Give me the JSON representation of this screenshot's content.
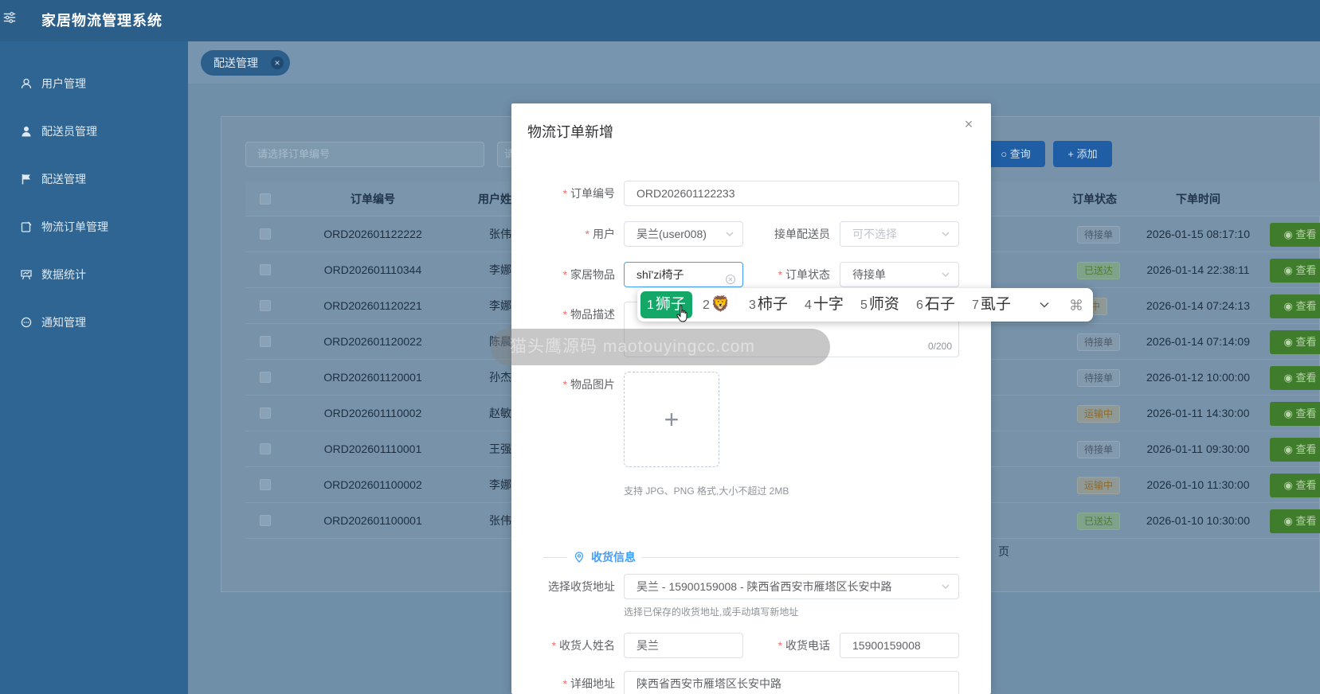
{
  "app": {
    "title": "家居物流管理系统"
  },
  "sidebar": {
    "items": [
      {
        "label": "用户管理",
        "icon": "user-icon"
      },
      {
        "label": "配送员管理",
        "icon": "courier-icon"
      },
      {
        "label": "配送管理",
        "icon": "flag-icon"
      },
      {
        "label": "物流订单管理",
        "icon": "order-icon"
      },
      {
        "label": "数据统计",
        "icon": "chart-icon"
      },
      {
        "label": "通知管理",
        "icon": "message-icon"
      }
    ]
  },
  "tabs": [
    {
      "label": "配送管理",
      "close": "×"
    }
  ],
  "toolbar": {
    "search_placeholder": "请选择订单编号",
    "search2_placeholder": "请",
    "query_label": "查询",
    "add_label": "添加"
  },
  "table": {
    "columns": [
      "订单编号",
      "用户姓名",
      "订单状态",
      "下单时间"
    ],
    "rows": [
      {
        "order_no": "ORD202601122222",
        "user": "张伟",
        "status": "待接单",
        "time": "2026-01-15 08:17:10",
        "action": "查看"
      },
      {
        "order_no": "ORD202601110344",
        "user": "李娜",
        "status": "已送达",
        "time": "2026-01-14 22:38:11",
        "action": "查看"
      },
      {
        "order_no": "ORD202601120221",
        "user": "李娜",
        "status": "中",
        "time": "2026-01-14 07:24:13",
        "action": "查看"
      },
      {
        "order_no": "ORD202601120022",
        "user": "陈晨",
        "status": "待接单",
        "time": "2026-01-14 07:14:09",
        "action": "查看"
      },
      {
        "order_no": "ORD202601120001",
        "user": "孙杰",
        "status": "待接单",
        "time": "2026-01-12 10:00:00",
        "action": "查看"
      },
      {
        "order_no": "ORD202601110002",
        "user": "赵敏",
        "status": "运输中",
        "time": "2026-01-11 14:30:00",
        "action": "查看"
      },
      {
        "order_no": "ORD202601110001",
        "user": "王强",
        "status": "待接单",
        "time": "2026-01-11 09:30:00",
        "action": "查看"
      },
      {
        "order_no": "ORD202601100002",
        "user": "李娜",
        "status": "运输中",
        "time": "2026-01-10 11:30:00",
        "action": "查看"
      },
      {
        "order_no": "ORD202601100001",
        "user": "张伟",
        "status": "已送达",
        "time": "2026-01-10 10:30:00",
        "action": "查看"
      }
    ],
    "pager_suffix": "页"
  },
  "dialog": {
    "title": "物流订单新增",
    "close": "×",
    "order_no": {
      "label": "订单编号",
      "value": "ORD202601122233"
    },
    "user": {
      "label": "用户",
      "value": "吴兰(user008)"
    },
    "courier": {
      "label": "接单配送员",
      "placeholder": "可不选择"
    },
    "item": {
      "label": "家居物品",
      "value": "shī'zi椅子"
    },
    "order_status": {
      "label": "订单状态",
      "value": "待接单"
    },
    "description": {
      "label": "物品描述",
      "count": "0/200"
    },
    "image": {
      "label": "物品图片",
      "plus": "+",
      "hint": "支持 JPG、PNG 格式,大小不超过 2MB"
    },
    "receive_section": "收货信息",
    "address_select": {
      "label": "选择收货地址",
      "value": "吴兰 - 15900159008 - 陕西省西安市雁塔区长安中路",
      "hint": "选择已保存的收货地址,或手动填写新地址"
    },
    "receiver_name": {
      "label": "收货人姓名",
      "value": "吴兰"
    },
    "receiver_phone": {
      "label": "收货电话",
      "value": "15900159008"
    },
    "address_detail": {
      "label": "详细地址",
      "value": "陕西省西安市雁塔区长安中路"
    }
  },
  "ime": {
    "candidates": [
      {
        "n": "1",
        "text": "狮子"
      },
      {
        "n": "2",
        "text": "🦁"
      },
      {
        "n": "3",
        "text": "柿子"
      },
      {
        "n": "4",
        "text": "十字"
      },
      {
        "n": "5",
        "text": "师资"
      },
      {
        "n": "6",
        "text": "石子"
      },
      {
        "n": "7",
        "text": "虱子"
      }
    ]
  },
  "watermark": "猫头鹰源码 maotouyingcc.com",
  "colors": {
    "primary": "#409eff",
    "required": "#f56c6c",
    "ime_selected": "#13a867",
    "sidebar": "#2e6592"
  }
}
